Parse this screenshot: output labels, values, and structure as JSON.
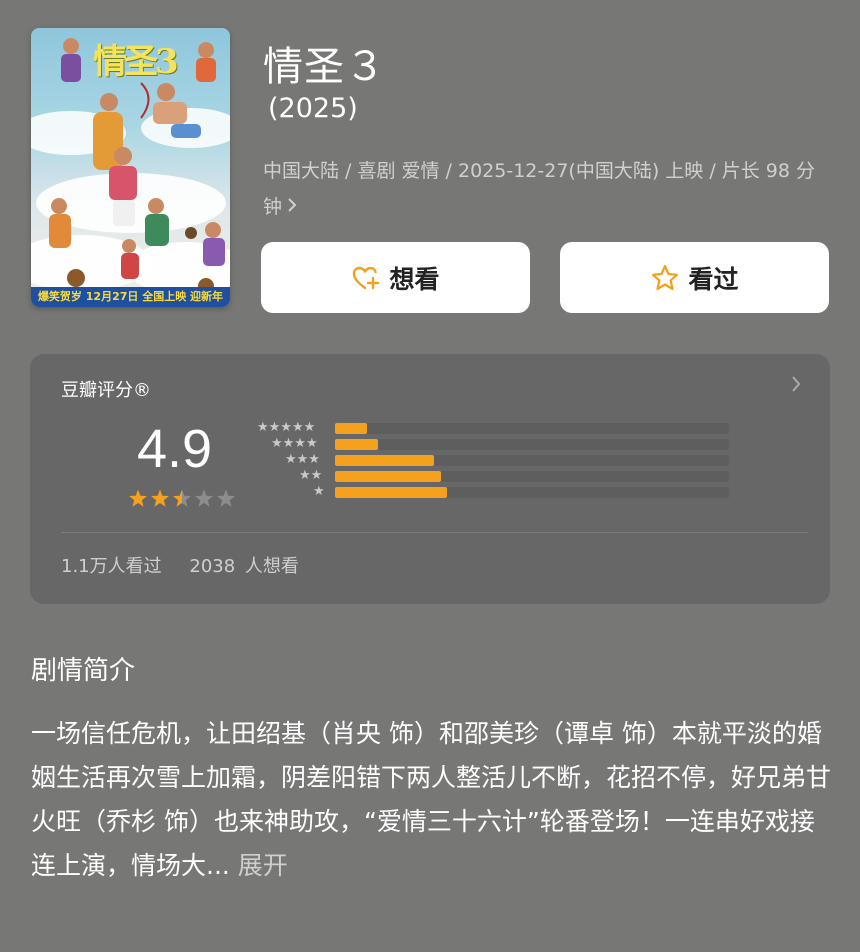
{
  "movie": {
    "poster_title": "情圣3",
    "poster_banner": "爆笑贺岁 12月27日 全国上映 迎新年",
    "title": "情圣３",
    "year": "(2025)",
    "meta": "中国大陆 / 喜剧 爱情 / 2025-12-27(中国大陆) 上映 / 片长 98 分钟"
  },
  "actions": {
    "want_label": "想看",
    "seen_label": "看过"
  },
  "rating": {
    "label": "豆瓣评分®",
    "score": "4.9",
    "stars_value": 2.5,
    "distribution": [
      {
        "stars": 5,
        "stars_text": "★★★★★",
        "fraction": 0.08
      },
      {
        "stars": 4,
        "stars_text": "★★★★",
        "fraction": 0.11
      },
      {
        "stars": 3,
        "stars_text": "★★★",
        "fraction": 0.25
      },
      {
        "stars": 2,
        "stars_text": "★★",
        "fraction": 0.27
      },
      {
        "stars": 1,
        "stars_text": "★",
        "fraction": 0.285
      }
    ],
    "watched": "1.1万人看过",
    "wish": "2038 人想看"
  },
  "synopsis": {
    "title": "剧情简介",
    "text": "一场信任危机，让田绍基（肖央 饰）和邵美珍（谭卓 饰）本就平淡的婚姻生活再次雪上加霜，阴差阳错下两人整活儿不断，花招不停，好兄弟甘火旺（乔杉 饰）也来神助攻，“爱情三十六计”轮番登场！一连串好戏接连上演，情场大...",
    "more": "展开"
  },
  "colors": {
    "background": "#777776",
    "card": "#676767",
    "accent": "#f4a11e"
  }
}
